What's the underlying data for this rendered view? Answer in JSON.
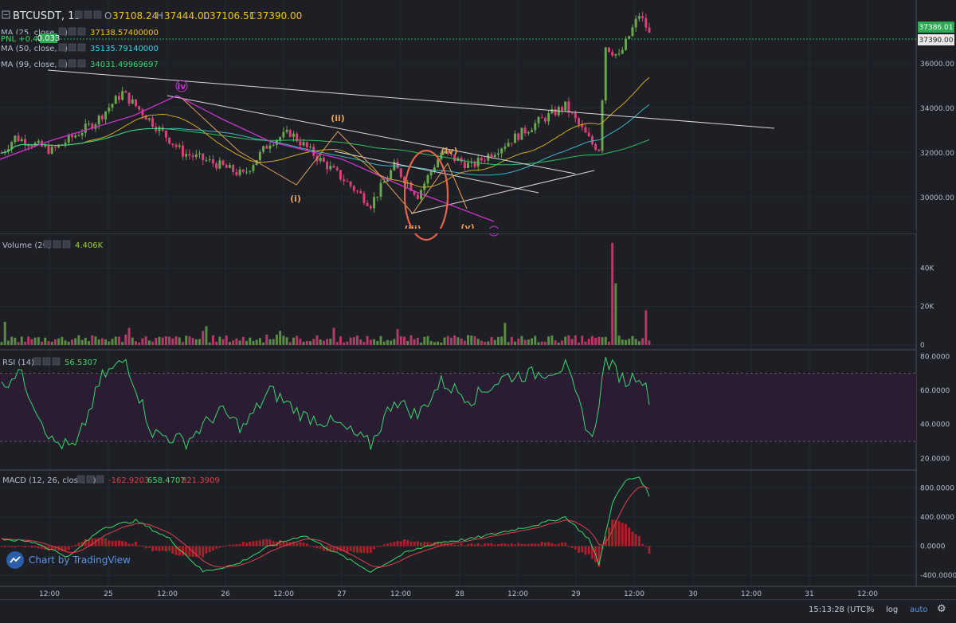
{
  "header": {
    "symbol": "BTCUSDT, 15",
    "open_label": "O",
    "open": "37108.24",
    "high_label": "H",
    "high": "37444.00",
    "low_label": "L",
    "low": "37106.51",
    "close_label": "C",
    "close": "37390.00"
  },
  "pnl": {
    "label": "PNL +0.42",
    "value": "0.033"
  },
  "ma_legend": [
    {
      "label": "MA (25, close, 0)",
      "value": "37138.57400000",
      "color": "#f0c419"
    },
    {
      "label": "MA (50, close, 0)",
      "value": "35135.79140000",
      "color": "#3fd0e0"
    },
    {
      "label": "MA (99, close, 0)",
      "value": "34031.49969697",
      "color": "#38d96a"
    }
  ],
  "volume_legend": {
    "label": "Volume (20)",
    "value": "4.406K"
  },
  "rsi_legend": {
    "label": "RSI (14)",
    "value": "56.5307"
  },
  "macd_legend": {
    "label": "MACD (12, 26, close, 9)",
    "v1": "-162.9203",
    "v2": "658.4707",
    "v3": "821.3909"
  },
  "price_tags": {
    "last": "37386.01",
    "close": "37390.00"
  },
  "wave_labels": [
    "iv",
    "(ii)",
    "(i)",
    "(iv)",
    "(iii)",
    "(v)",
    "v"
  ],
  "footer": {
    "branding": "Chart by TradingView",
    "time": "15:13:28 (UTC)",
    "pct": "%",
    "log": "log",
    "auto": "auto"
  },
  "colors": {
    "up": "#6aa84f",
    "down": "#e0407a",
    "ma25": "#f0c419",
    "ma50": "#3fd0e0",
    "ma99": "#38d96a",
    "wave_purple": "#cc33cc",
    "wave_orange": "#e8a05a",
    "highlight": "#e8634a",
    "trend": "#d8d8d8"
  },
  "icons": [
    "collapse-icon",
    "settings-icon",
    "tradingview-logo-icon",
    "gear-icon"
  ],
  "chart_data": [
    {
      "type": "candlestick",
      "name": "BTCUSDT price",
      "ylim": [
        28600,
        38500
      ],
      "y_ticks": [
        30000,
        32000,
        34000,
        36000
      ],
      "y_tick_labels": [
        "30000.00",
        "32000.00",
        "34000.00",
        "36000.00"
      ],
      "x_ticks": [
        "12:00",
        "25",
        "12:00",
        "26",
        "12:00",
        "27",
        "12:00",
        "28",
        "12:00",
        "29",
        "12:00",
        "30",
        "12:00",
        "31",
        "12:00"
      ],
      "key_points": [
        {
          "t": 0,
          "price": 32000
        },
        {
          "t": 4,
          "price": 32700
        },
        {
          "t": 15,
          "price": 32100
        },
        {
          "t": 28,
          "price": 33400
        },
        {
          "t": 36,
          "price": 34700
        },
        {
          "t": 44,
          "price": 33500
        },
        {
          "t": 54,
          "price": 32000
        },
        {
          "t": 64,
          "price": 31500
        },
        {
          "t": 72,
          "price": 31000
        },
        {
          "t": 80,
          "price": 32500
        },
        {
          "t": 86,
          "price": 32900
        },
        {
          "t": 94,
          "price": 31800
        },
        {
          "t": 102,
          "price": 30800
        },
        {
          "t": 110,
          "price": 29700
        },
        {
          "t": 117,
          "price": 31400
        },
        {
          "t": 124,
          "price": 30100
        },
        {
          "t": 131,
          "price": 32000
        },
        {
          "t": 140,
          "price": 31400
        },
        {
          "t": 150,
          "price": 32400
        },
        {
          "t": 160,
          "price": 33400
        },
        {
          "t": 168,
          "price": 34100
        },
        {
          "t": 176,
          "price": 32400
        },
        {
          "t": 178,
          "price": 32200
        },
        {
          "t": 180,
          "price": 36800
        },
        {
          "t": 184,
          "price": 36300
        },
        {
          "t": 190,
          "price": 38200
        },
        {
          "t": 193,
          "price": 37400
        }
      ]
    },
    {
      "type": "bar",
      "name": "Volume (20)",
      "ylim": [
        0,
        55000
      ],
      "y_ticks": [
        0,
        20000,
        40000
      ],
      "y_tick_labels": [
        "0",
        "20K",
        "40K"
      ],
      "typical_value": 3000,
      "spikes": [
        {
          "t": 182,
          "value": 53000
        },
        {
          "t": 183,
          "value": 32000
        },
        {
          "t": 192,
          "value": 18000
        }
      ]
    },
    {
      "type": "line",
      "name": "RSI (14)",
      "ylim": [
        15,
        82
      ],
      "y_ticks": [
        20,
        40,
        60,
        80
      ],
      "y_tick_labels": [
        "20.0000",
        "40.0000",
        "60.0000",
        "80.0000"
      ],
      "bands": [
        30,
        70
      ],
      "key_points": [
        {
          "t": 0,
          "v": 62
        },
        {
          "t": 5,
          "v": 72
        },
        {
          "t": 15,
          "v": 30
        },
        {
          "t": 22,
          "v": 26
        },
        {
          "t": 30,
          "v": 68
        },
        {
          "t": 37,
          "v": 78
        },
        {
          "t": 45,
          "v": 35
        },
        {
          "t": 55,
          "v": 30
        },
        {
          "t": 65,
          "v": 48
        },
        {
          "t": 72,
          "v": 38
        },
        {
          "t": 80,
          "v": 60
        },
        {
          "t": 90,
          "v": 45
        },
        {
          "t": 100,
          "v": 40
        },
        {
          "t": 110,
          "v": 28
        },
        {
          "t": 117,
          "v": 55
        },
        {
          "t": 124,
          "v": 45
        },
        {
          "t": 131,
          "v": 65
        },
        {
          "t": 140,
          "v": 55
        },
        {
          "t": 150,
          "v": 68
        },
        {
          "t": 160,
          "v": 70
        },
        {
          "t": 168,
          "v": 74
        },
        {
          "t": 176,
          "v": 30
        },
        {
          "t": 180,
          "v": 78
        },
        {
          "t": 186,
          "v": 65
        },
        {
          "t": 190,
          "v": 70
        },
        {
          "t": 193,
          "v": 56
        }
      ]
    },
    {
      "type": "line",
      "name": "MACD (12, 26, close, 9)",
      "ylim": [
        -520,
        1000
      ],
      "y_ticks": [
        -400,
        0,
        400,
        800
      ],
      "y_tick_labels": [
        "-400.0000",
        "0.0000",
        "400.0000",
        "800.0000"
      ],
      "key_points": [
        {
          "t": 0,
          "v": 100
        },
        {
          "t": 10,
          "v": 50
        },
        {
          "t": 20,
          "v": -150
        },
        {
          "t": 30,
          "v": 250
        },
        {
          "t": 40,
          "v": 350
        },
        {
          "t": 50,
          "v": 100
        },
        {
          "t": 60,
          "v": -350
        },
        {
          "t": 70,
          "v": -250
        },
        {
          "t": 80,
          "v": 0
        },
        {
          "t": 90,
          "v": 150
        },
        {
          "t": 100,
          "v": -100
        },
        {
          "t": 110,
          "v": -350
        },
        {
          "t": 120,
          "v": -100
        },
        {
          "t": 130,
          "v": 50
        },
        {
          "t": 140,
          "v": 100
        },
        {
          "t": 150,
          "v": 200
        },
        {
          "t": 160,
          "v": 300
        },
        {
          "t": 168,
          "v": 400
        },
        {
          "t": 175,
          "v": 100
        },
        {
          "t": 178,
          "v": -250
        },
        {
          "t": 182,
          "v": 600
        },
        {
          "t": 186,
          "v": 900
        },
        {
          "t": 190,
          "v": 950
        },
        {
          "t": 193,
          "v": 700
        }
      ]
    }
  ]
}
